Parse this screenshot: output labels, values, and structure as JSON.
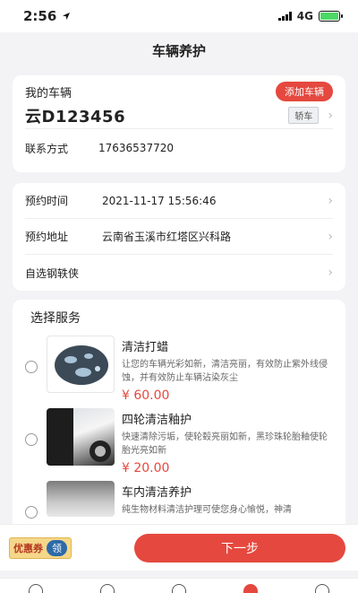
{
  "status_bar": {
    "time": "2:56",
    "network": "4G"
  },
  "nav": {
    "title": "车辆养护"
  },
  "vehicle": {
    "section_label": "我的车辆",
    "add_button": "添加车辆",
    "plate": "云D123456",
    "type": "轿车",
    "contact_label": "联系方式",
    "contact_value": "17636537720"
  },
  "appointment": {
    "rows": [
      {
        "label": "预约时间",
        "value": "2021-11-17 15:56:46"
      },
      {
        "label": "预约地址",
        "value": "云南省玉溪市红塔区兴科路"
      },
      {
        "label": "自选钢轶侠",
        "value": ""
      }
    ]
  },
  "services": {
    "title": "选择服务",
    "items": [
      {
        "name": "清洁打蜡",
        "desc": "让您的车辆光彩如新，清洁亮丽，有效防止紫外线侵蚀，并有效防止车辆沾染灰尘",
        "price": "¥ 60.00"
      },
      {
        "name": "四轮清洁釉护",
        "desc": "快速清除污垢，使轮毂亮丽如新，黑珍珠轮胎釉使轮胎光亮如新",
        "price": "¥ 20.00"
      },
      {
        "name": "车内清洁养护",
        "desc": "纯生物材料清洁护理可使您身心愉悦，神清",
        "price": ""
      }
    ]
  },
  "bottom": {
    "coupon_label": "优惠券",
    "coupon_claim": "领",
    "next_button": "下一步"
  },
  "tabbar": {
    "icons": [
      "home-icon",
      "cart-icon",
      "user-icon",
      "bag-icon",
      "profile-icon"
    ],
    "active_index": 3
  },
  "colors": {
    "accent": "#e5483e",
    "background": "#f3f3f5"
  }
}
